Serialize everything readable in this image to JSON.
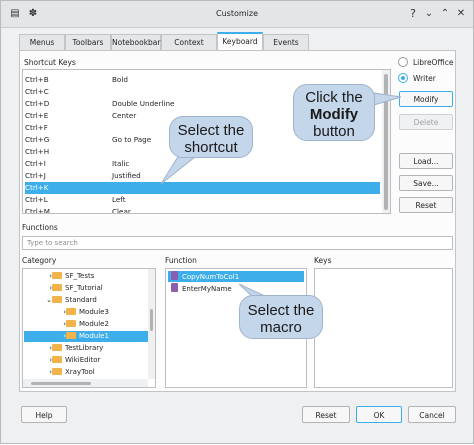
{
  "window": {
    "title": "Customize"
  },
  "tabs": [
    {
      "label": "Menus"
    },
    {
      "label": "Toolbars"
    },
    {
      "label": "Notebookbar"
    },
    {
      "label": "Context Menus"
    },
    {
      "label": "Keyboard"
    },
    {
      "label": "Events"
    }
  ],
  "shortcut_keys": {
    "label": "Shortcut Keys",
    "rows": [
      {
        "key": "Ctrl+B",
        "cmd": "Bold"
      },
      {
        "key": "Ctrl+C",
        "cmd": ""
      },
      {
        "key": "Ctrl+D",
        "cmd": "Double Underline"
      },
      {
        "key": "Ctrl+E",
        "cmd": "Center"
      },
      {
        "key": "Ctrl+F",
        "cmd": ""
      },
      {
        "key": "Ctrl+G",
        "cmd": "Go to Page"
      },
      {
        "key": "Ctrl+H",
        "cmd": ""
      },
      {
        "key": "Ctrl+I",
        "cmd": "Italic"
      },
      {
        "key": "Ctrl+J",
        "cmd": "Justified"
      },
      {
        "key": "Ctrl+K",
        "cmd": ""
      },
      {
        "key": "Ctrl+L",
        "cmd": "Left"
      },
      {
        "key": "Ctrl+M",
        "cmd": "Clear"
      }
    ]
  },
  "scope": {
    "libreoffice": "LibreOffice",
    "writer": "Writer"
  },
  "buttons": {
    "modify": "Modify",
    "delete": "Delete",
    "load": "Load...",
    "save": "Save...",
    "reset": "Reset"
  },
  "functions": {
    "label": "Functions",
    "search_placeholder": "Type to search"
  },
  "category": {
    "label": "Category",
    "items": [
      {
        "label": "SF_Tests"
      },
      {
        "label": "SF_Tutorial"
      },
      {
        "label": "Standard"
      },
      {
        "label": "Module3"
      },
      {
        "label": "Module2"
      },
      {
        "label": "Module1"
      },
      {
        "label": "TestLibrary"
      },
      {
        "label": "WikiEditor"
      },
      {
        "label": "XrayTool"
      }
    ]
  },
  "function": {
    "label": "Function",
    "items": [
      {
        "label": "CopyNumToCol1"
      },
      {
        "label": "EnterMyName"
      }
    ]
  },
  "keys": {
    "label": "Keys"
  },
  "footer": {
    "help": "Help",
    "reset": "Reset",
    "ok": "OK",
    "cancel": "Cancel"
  },
  "callouts": {
    "modify_line1": "Click the",
    "modify_line2": "Modify",
    "modify_line3": "button",
    "shortcut_line1": "Select the",
    "shortcut_line2": "shortcut",
    "macro_line1": "Select the",
    "macro_line2": "macro"
  },
  "colors": {
    "accent": "#3daee9",
    "callout": "#c4d6ea"
  },
  "icons": [
    "app-menu-icon",
    "pin-icon",
    "help-icon",
    "minimize-icon",
    "maximize-icon",
    "close-icon"
  ]
}
